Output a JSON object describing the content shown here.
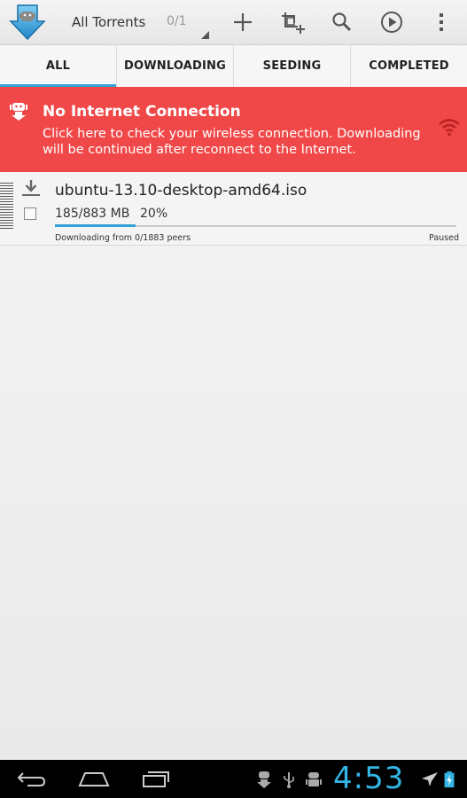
{
  "actionbar": {
    "spinner_title": "All Torrents",
    "spinner_count": "0/1",
    "icons": [
      "app-logo-icon",
      "add-icon",
      "crop-add-icon",
      "search-icon",
      "play-icon",
      "overflow-menu-icon"
    ]
  },
  "tabs": [
    {
      "label": "ALL",
      "active": true
    },
    {
      "label": "DOWNLOADING",
      "active": false
    },
    {
      "label": "SEEDING",
      "active": false
    },
    {
      "label": "COMPLETED",
      "active": false
    }
  ],
  "banner": {
    "title": "No Internet Connection",
    "message": "Click here to check your wireless connection. Downloading will be continued after reconnect to the Internet.",
    "color": "#f04848"
  },
  "torrent": {
    "name": "ubuntu-13.10-desktop-amd64.iso",
    "size": "185/883 MB",
    "percent": "20%",
    "progress": 0.2,
    "peers": "Downloading from 0/1883 peers",
    "state": "Paused"
  },
  "statusbar": {
    "time": "4:53"
  },
  "colors": {
    "accent": "#33a2d7",
    "clock": "#33b5e5"
  }
}
